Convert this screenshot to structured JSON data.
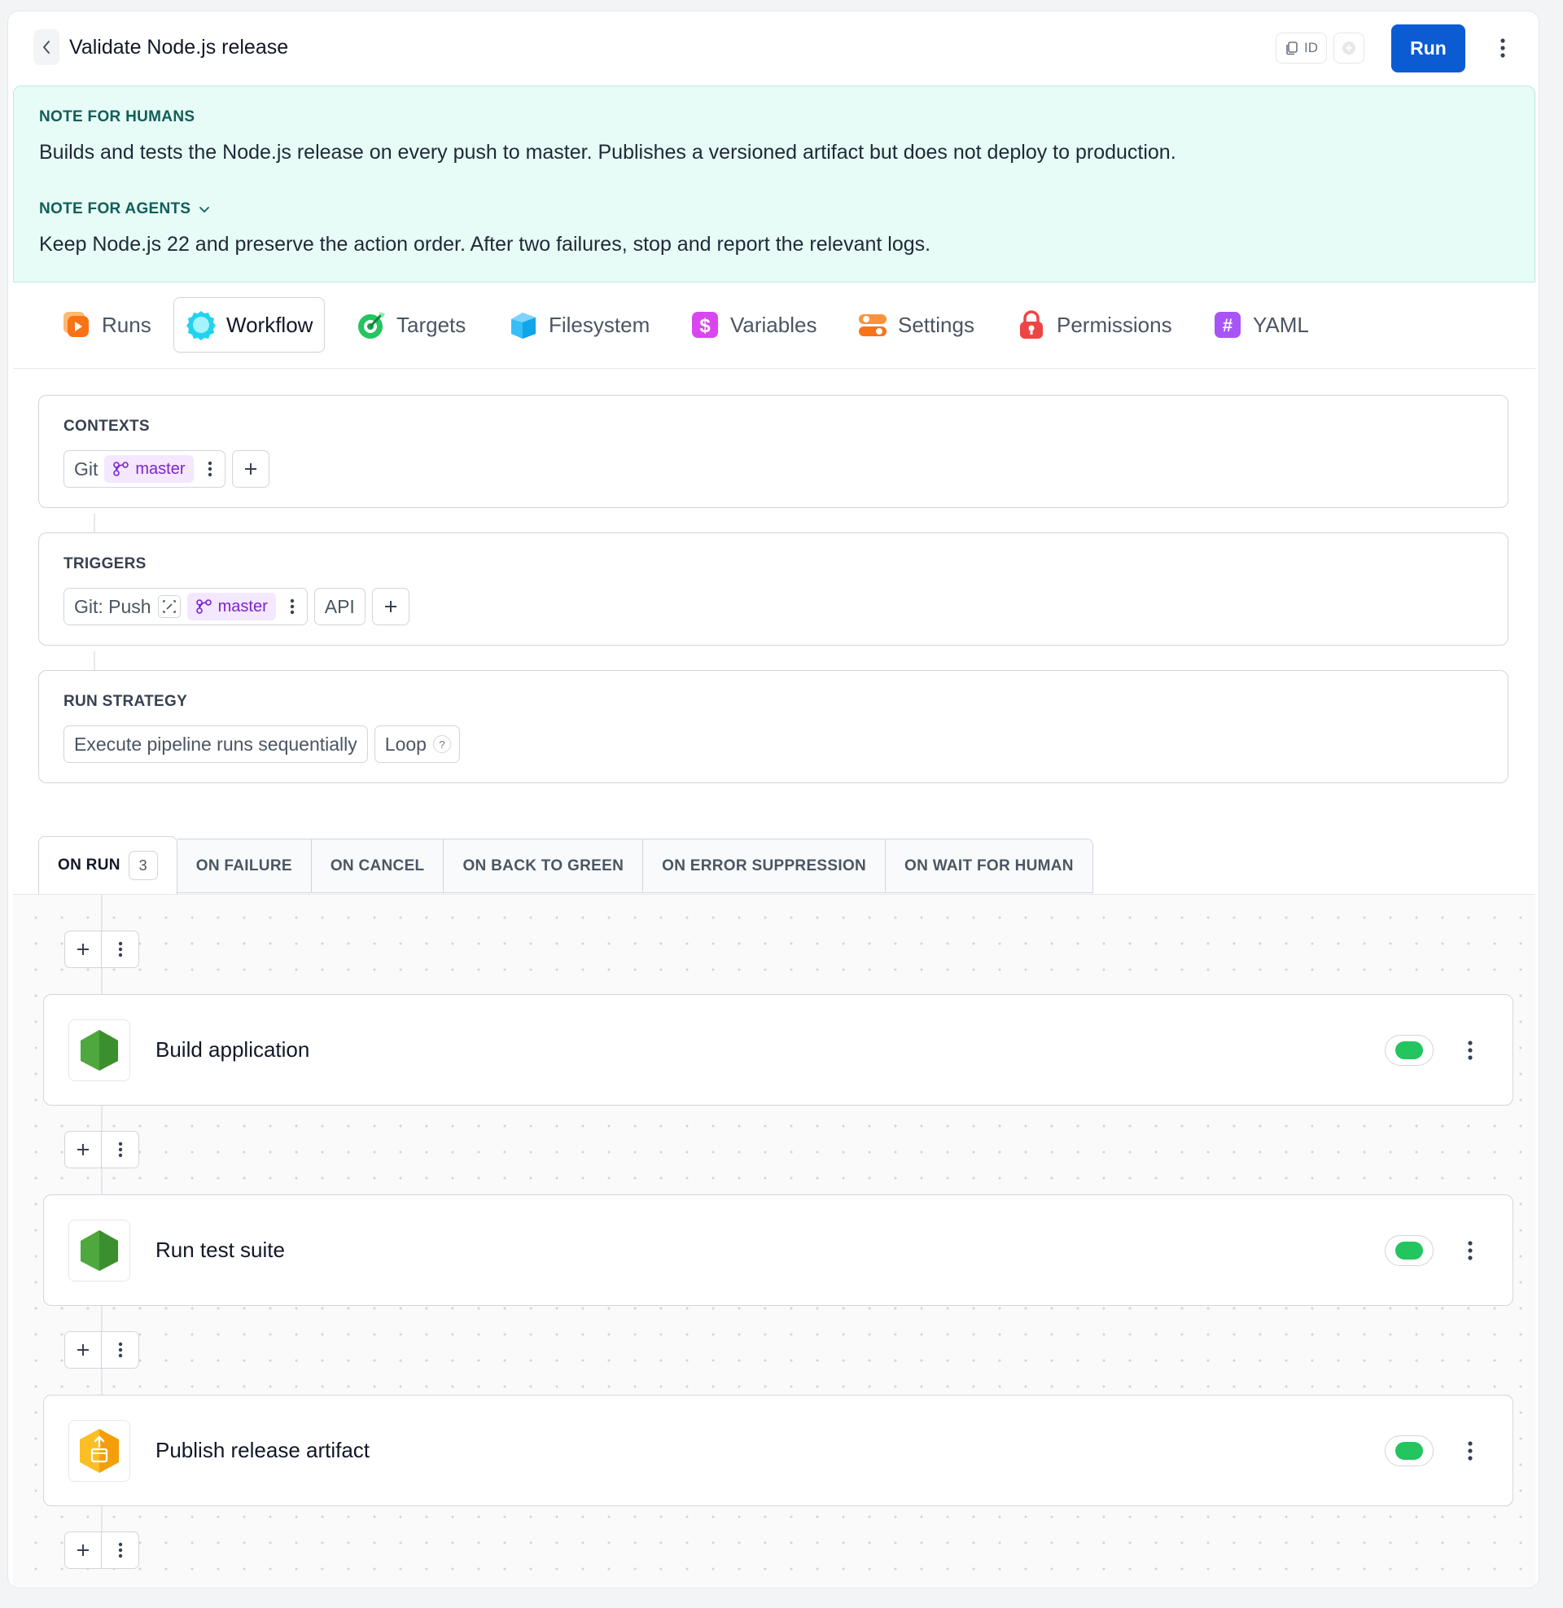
{
  "header": {
    "title": "Validate Node.js release",
    "id_label": "ID",
    "run_label": "Run"
  },
  "notes": {
    "humans_label": "NOTE FOR HUMANS",
    "humans_text": "Builds and tests the Node.js release on every push to master. Publishes a versioned artifact but does not deploy to production.",
    "agents_label": "NOTE FOR AGENTS",
    "agents_text": "Keep Node.js 22 and preserve the action order. After two failures, stop and report the relevant logs."
  },
  "tabs": [
    {
      "label": "Runs",
      "icon": "runs-icon"
    },
    {
      "label": "Workflow",
      "icon": "workflow-icon",
      "active": true
    },
    {
      "label": "Targets",
      "icon": "targets-icon"
    },
    {
      "label": "Filesystem",
      "icon": "filesystem-icon"
    },
    {
      "label": "Variables",
      "icon": "variables-icon"
    },
    {
      "label": "Settings",
      "icon": "settings-icon"
    },
    {
      "label": "Permissions",
      "icon": "permissions-icon"
    },
    {
      "label": "YAML",
      "icon": "yaml-icon"
    }
  ],
  "contexts": {
    "label": "CONTEXTS",
    "git_label": "Git",
    "branch": "master"
  },
  "triggers": {
    "label": "TRIGGERS",
    "push_label": "Git: Push",
    "branch": "master",
    "api_label": "API"
  },
  "run_strategy": {
    "label": "RUN STRATEGY",
    "mode": "Execute pipeline runs sequentially",
    "loop_label": "Loop",
    "help": "?"
  },
  "event_tabs": [
    {
      "label": "ON RUN",
      "count": "3",
      "active": true
    },
    {
      "label": "ON FAILURE"
    },
    {
      "label": "ON CANCEL"
    },
    {
      "label": "ON BACK TO GREEN"
    },
    {
      "label": "ON ERROR SUPPRESSION"
    },
    {
      "label": "ON WAIT FOR HUMAN"
    }
  ],
  "actions": [
    {
      "name": "Build application",
      "icon": "nodejs-icon",
      "enabled": true
    },
    {
      "name": "Run test suite",
      "icon": "nodejs-icon",
      "enabled": true
    },
    {
      "name": "Publish release artifact",
      "icon": "publish-artifact-icon",
      "enabled": true
    }
  ],
  "colors": {
    "primary": "#0b5bd3",
    "note_bg": "#e7fcf6",
    "branch_bg": "#f3e8ff",
    "branch_text": "#7e22ce",
    "toggle_on": "#22c55e"
  }
}
